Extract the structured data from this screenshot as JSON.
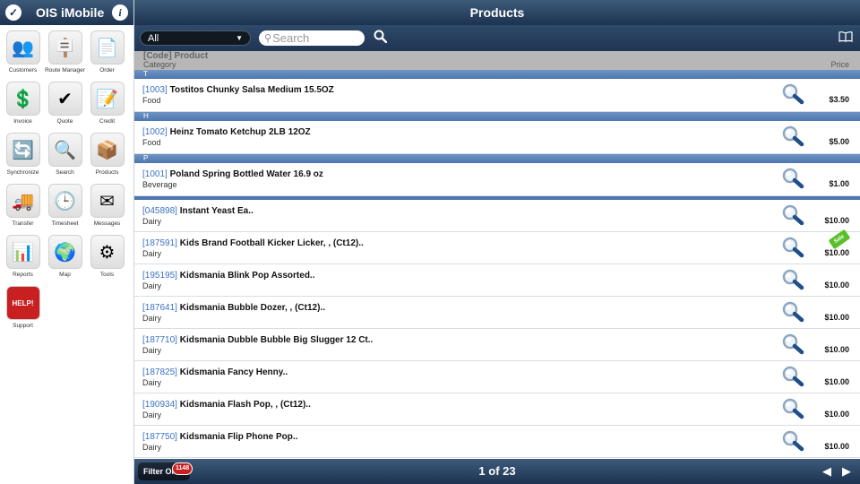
{
  "app": {
    "title": "OIS iMobile",
    "info_glyph": "i"
  },
  "sidebar": {
    "items": [
      {
        "label": "Customers",
        "icon": "customers-icon",
        "glyph": "👥"
      },
      {
        "label": "Route Manager",
        "icon": "signpost-icon",
        "glyph": "🪧"
      },
      {
        "label": "Order",
        "icon": "new-order-icon",
        "glyph": "📄"
      },
      {
        "label": "Invoice",
        "icon": "invoice-icon",
        "glyph": "💲"
      },
      {
        "label": "Quote",
        "icon": "quote-check-icon",
        "glyph": "✔"
      },
      {
        "label": "Credit",
        "icon": "credit-icon",
        "glyph": "📝"
      },
      {
        "label": "Synchronize",
        "icon": "sync-icon",
        "glyph": "🔄"
      },
      {
        "label": "Search",
        "icon": "search-doc-icon",
        "glyph": "🔍"
      },
      {
        "label": "Products",
        "icon": "products-box-icon",
        "glyph": "📦"
      },
      {
        "label": "Transfer",
        "icon": "truck-icon",
        "glyph": "🚚"
      },
      {
        "label": "Timesheet",
        "icon": "clock-icon",
        "glyph": "🕒"
      },
      {
        "label": "Messages",
        "icon": "envelope-icon",
        "glyph": "✉"
      },
      {
        "label": "Reports",
        "icon": "pie-chart-icon",
        "glyph": "📊"
      },
      {
        "label": "Map",
        "icon": "globe-icon",
        "glyph": "🌍"
      },
      {
        "label": "Tools",
        "icon": "gear-icon",
        "glyph": "⚙"
      },
      {
        "label": "Support",
        "icon": "help-sign-icon",
        "glyph": "HELP!"
      }
    ]
  },
  "header": {
    "title": "Products"
  },
  "toolbar": {
    "filter_value": "All",
    "search_placeholder": "Search",
    "search_icon": "search-icon",
    "book_icon": "book-icon"
  },
  "columns": {
    "code_product": "[Code] Product",
    "category": "Category",
    "price": "Price"
  },
  "groups": [
    {
      "letter": "T",
      "rows": [
        {
          "code": "[1003]",
          "name": "Tostitos Chunky Salsa Medium 15.5OZ",
          "category": "Food",
          "price": "$3.50"
        }
      ]
    },
    {
      "letter": "H",
      "rows": [
        {
          "code": "[1002]",
          "name": "Heinz Tomato Ketchup 2LB 12OZ",
          "category": "Food",
          "price": "$5.00"
        }
      ]
    },
    {
      "letter": "P",
      "rows": [
        {
          "code": "[1001]",
          "name": "Poland Spring Bottled Water 16.9 oz",
          "category": "Beverage",
          "price": "$1.00"
        }
      ]
    }
  ],
  "products": [
    {
      "code": "[045898]",
      "name": "Instant Yeast Ea..",
      "category": "Dairy",
      "price": "$10.00"
    },
    {
      "code": "[187591]",
      "name": "Kids Brand Football Kicker Licker, , (Ct12)..",
      "category": "Dairy",
      "price": "$10.00",
      "badge": "Sale"
    },
    {
      "code": "[195195]",
      "name": "Kidsmania Blink Pop Assorted..",
      "category": "Dairy",
      "price": "$10.00"
    },
    {
      "code": "[187641]",
      "name": "Kidsmania Bubble Dozer, , (Ct12)..",
      "category": "Dairy",
      "price": "$10.00"
    },
    {
      "code": "[187710]",
      "name": "Kidsmania Dubble Bubble Big Slugger 12 Ct..",
      "category": "Dairy",
      "price": "$10.00"
    },
    {
      "code": "[187825]",
      "name": "Kidsmania Fancy Henny..",
      "category": "Dairy",
      "price": "$10.00"
    },
    {
      "code": "[190934]",
      "name": "Kidsmania Flash Pop, , (Ct12)..",
      "category": "Dairy",
      "price": "$10.00"
    },
    {
      "code": "[187750]",
      "name": "Kidsmania Flip Phone Pop..",
      "category": "Dairy",
      "price": "$10.00"
    }
  ],
  "footer": {
    "filter_label": "Filter On",
    "filter_count": "1148",
    "page_text": "1 of 23",
    "prev_glyph": "◀",
    "next_glyph": "▶"
  }
}
